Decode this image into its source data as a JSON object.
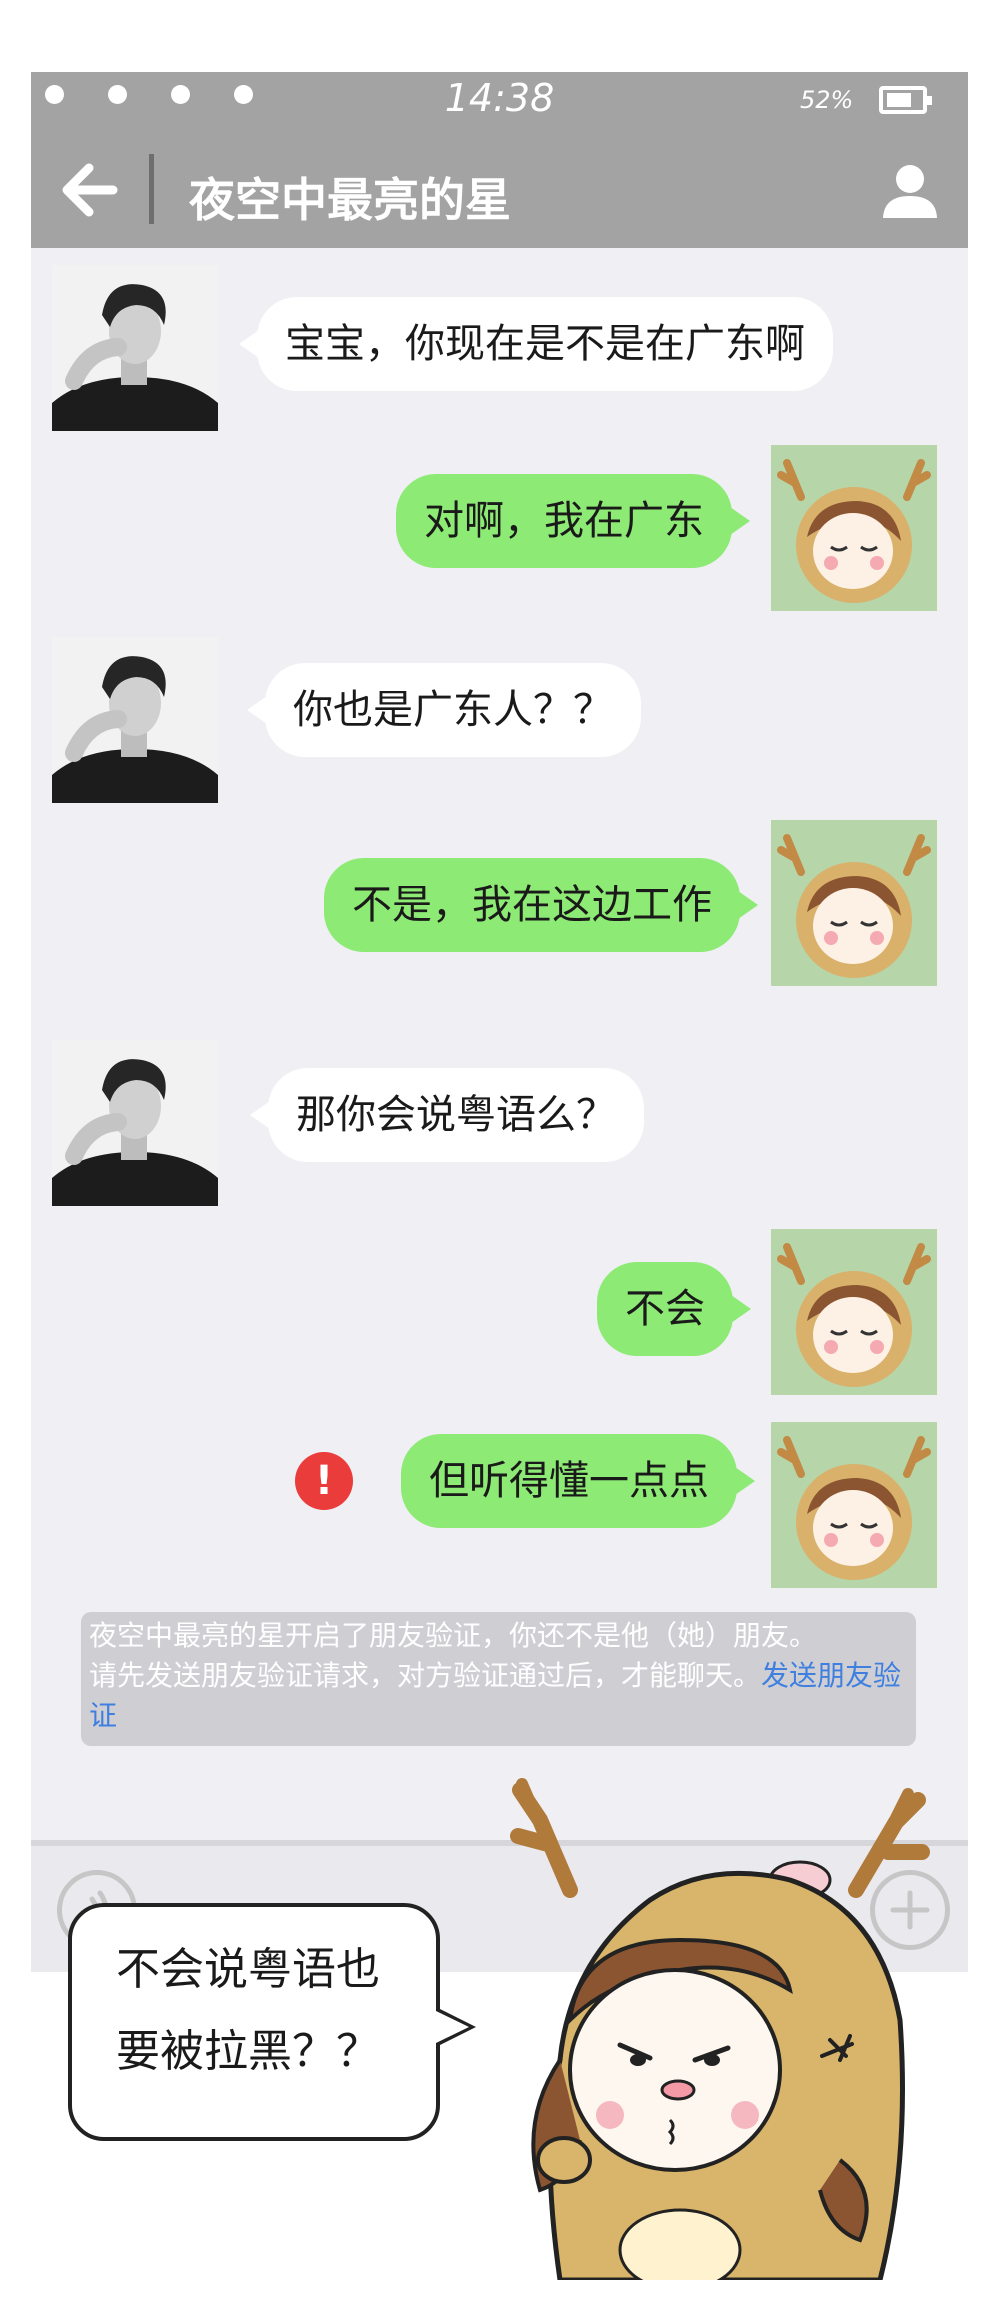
{
  "status_bar": {
    "time": "14:38",
    "battery_percent": "52%"
  },
  "header": {
    "contact_name": "夜空中最亮的星"
  },
  "messages": [
    {
      "side": "left",
      "text": "宝宝，你现在是不是在广东啊"
    },
    {
      "side": "right",
      "text": "对啊，我在广东"
    },
    {
      "side": "left",
      "text": "你也是广东人？？"
    },
    {
      "side": "right",
      "text": "不是，我在这边工作"
    },
    {
      "side": "left",
      "text": "那你会说粤语么？"
    },
    {
      "side": "right",
      "text": "不会"
    },
    {
      "side": "right",
      "text": "但听得懂一点点",
      "failed": true
    }
  ],
  "error_icon_glyph": "!",
  "system_notice": {
    "line1": "夜空中最亮的星开启了朋友验证，你还不是他（她）朋友。",
    "line2": "请先发送朋友验证请求，对方验证通过后，才能聊天。",
    "link": "发送朋友验证"
  },
  "overlay_caption": {
    "line1": "不会说粤语也",
    "line2": "要被拉黑？？"
  },
  "colors": {
    "header_bg": "#a3a3a3",
    "sent_bubble": "#8dea74",
    "received_bubble": "#ffffff",
    "error": "#ea3c3a",
    "link": "#3f7fe0",
    "chat_bg": "#efeff4"
  },
  "icons": [
    "back-arrow-icon",
    "person-icon",
    "warning-icon",
    "voice-icon",
    "plus-icon"
  ]
}
